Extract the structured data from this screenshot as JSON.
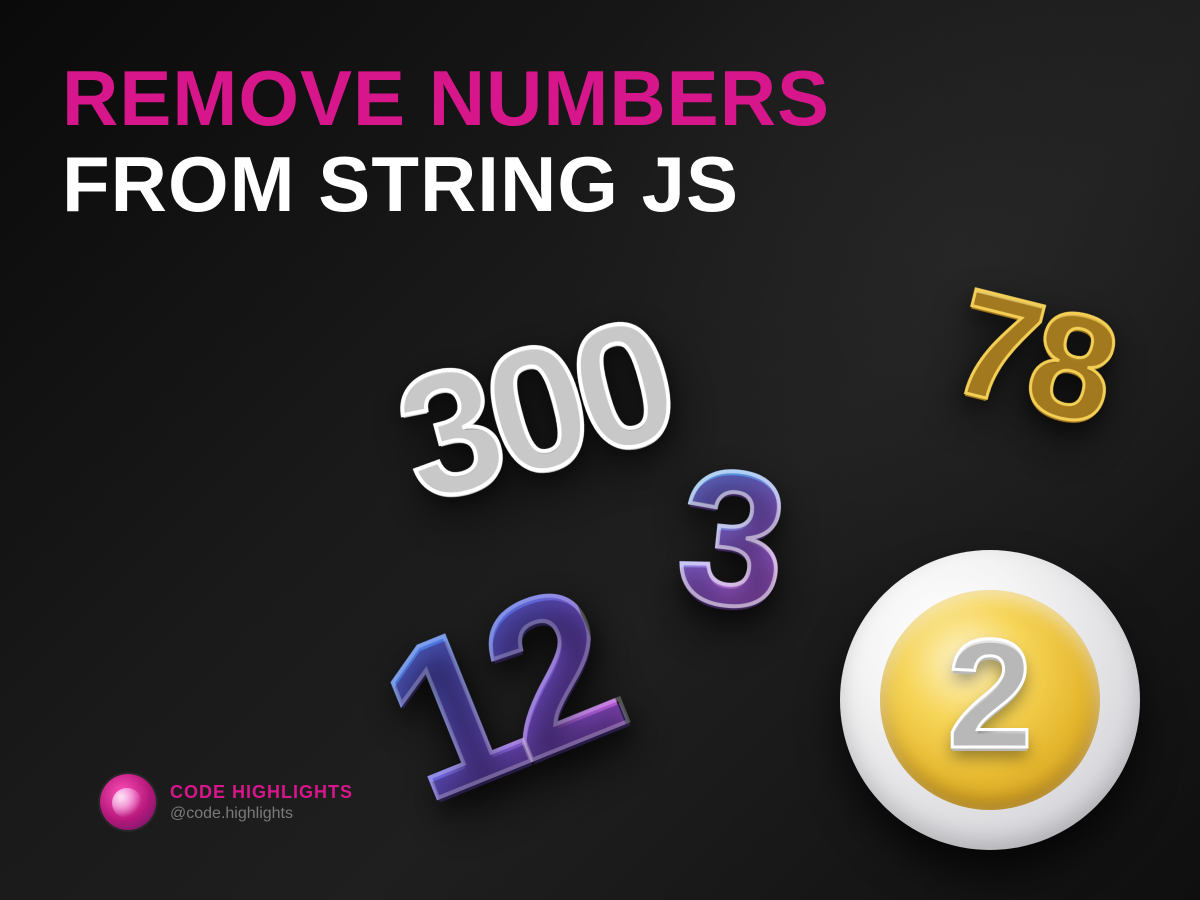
{
  "title": {
    "line1": "REMOVE NUMBERS",
    "line2": "FROM STRING JS"
  },
  "attribution": {
    "name": "CODE HIGHLIGHTS",
    "handle": "@code.highlights"
  },
  "numbers": {
    "n300": "300",
    "n78": "78",
    "n3": "3",
    "n12": "12",
    "coin": "2"
  },
  "colors": {
    "accent_pink": "#d8168b",
    "text_white": "#ffffff",
    "gold": "#e6b82f",
    "gradient_blue": "#5a9ff5",
    "gradient_purple": "#b67bf0"
  }
}
